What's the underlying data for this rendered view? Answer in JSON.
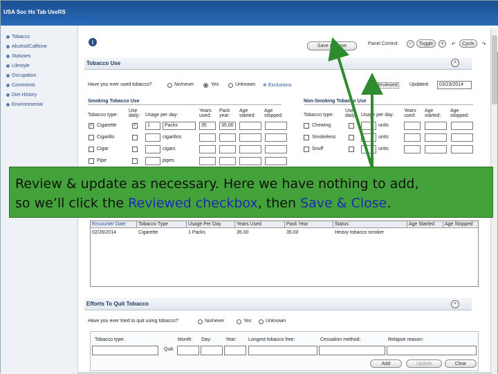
{
  "window": {
    "title": "USA Soc Hx Tab UseRS"
  },
  "sidebar": {
    "items": [
      {
        "label": "Tobacco"
      },
      {
        "label": "Alcohol/Caffeine"
      },
      {
        "label": "Statuses"
      },
      {
        "label": "Lifestyle"
      },
      {
        "label": "Occupation"
      },
      {
        "label": "Comments"
      },
      {
        "label": "Diet History"
      },
      {
        "label": "Environmental"
      }
    ]
  },
  "toolbar": {
    "save_close_label": "Save & Close",
    "panel_control_label": "Panel Control:",
    "toggle_label": "Toggle",
    "cycle_label": "Cycle"
  },
  "tobacco_use": {
    "header": "Tobacco Use",
    "question": "Have you ever used tobacco?",
    "options": [
      "No/never",
      "Yes",
      "Unknown"
    ],
    "selected": "Yes",
    "exclusions_label": "Exclusions",
    "reviewed_label": "Reviewed",
    "updated_label": "Updated:",
    "updated_value": "03/23/2014"
  },
  "smoking": {
    "header": "Smoking Tobacco Use",
    "col_type": "Tobacco type:",
    "col_daily": "Use daily:",
    "col_usage": "Usage per day:",
    "col_years": "Years used:",
    "col_pack": "Pack year:",
    "col_started": "Age started:",
    "col_stopped": "Age stopped:",
    "rows": [
      {
        "type": "Cigarette",
        "checked": true,
        "daily": true,
        "qty": "1",
        "unit": "Packs",
        "years": "35",
        "pack": "35.00"
      },
      {
        "type": "Cigarillo",
        "checked": false,
        "daily": false,
        "qty": "",
        "unit": "cigarillos",
        "years": "",
        "pack": ""
      },
      {
        "type": "Cigar",
        "checked": false,
        "daily": false,
        "qty": "",
        "unit": "cigars",
        "years": "",
        "pack": ""
      },
      {
        "type": "Pipe",
        "checked": false,
        "daily": false,
        "qty": "",
        "unit": "pipes",
        "years": "",
        "pack": ""
      }
    ]
  },
  "non_smoking": {
    "header": "Non-Smoking Tobacco Use",
    "rows": [
      {
        "type": "Chewing",
        "unit": "units"
      },
      {
        "type": "Smokeless",
        "unit": "units"
      },
      {
        "type": "Snuff",
        "unit": "units"
      }
    ]
  },
  "history_grid": {
    "columns": [
      "Encounter Date",
      "Tobacco Type",
      "Usage Per Day",
      "Years Used",
      "Pack Year",
      "Status",
      "Age Started",
      "Age Stopped"
    ],
    "rows": [
      [
        "02/26/2014",
        "Cigarette",
        "1 Packs",
        "35.00",
        "35.00",
        "Heavy tobacco smoker",
        "",
        ""
      ]
    ]
  },
  "efforts": {
    "header": "Efforts To Quit Tobacco",
    "question": "Have you ever tried to quit using tobacco?",
    "options": [
      "No/never",
      "Yes",
      "Unknown"
    ],
    "col_type": "Tobacco type:",
    "col_month": "Month:",
    "col_day": "Day:",
    "col_year": "Year:",
    "col_longest": "Longest tobacco free:",
    "col_method": "Cessation method:",
    "col_relapse": "Relapse reason:",
    "quit_label": "Quit:",
    "add_label": "Add",
    "update_label": "Update",
    "clear_label": "Clear"
  },
  "banner": {
    "line1": "Review & update as necessary.  Here we have nothing to add,",
    "line2_prefix": "so we’ll click the ",
    "line2_reviewed": "Reviewed checkbox",
    "line2_mid": ", then ",
    "line2_save": "Save & Close",
    "line2_end": "."
  },
  "colors": {
    "banner_bg": "#44a23a",
    "arrow": "#2e8b2e",
    "highlight_text": "#1c2bb0",
    "titlebar": "#1b4f92"
  }
}
